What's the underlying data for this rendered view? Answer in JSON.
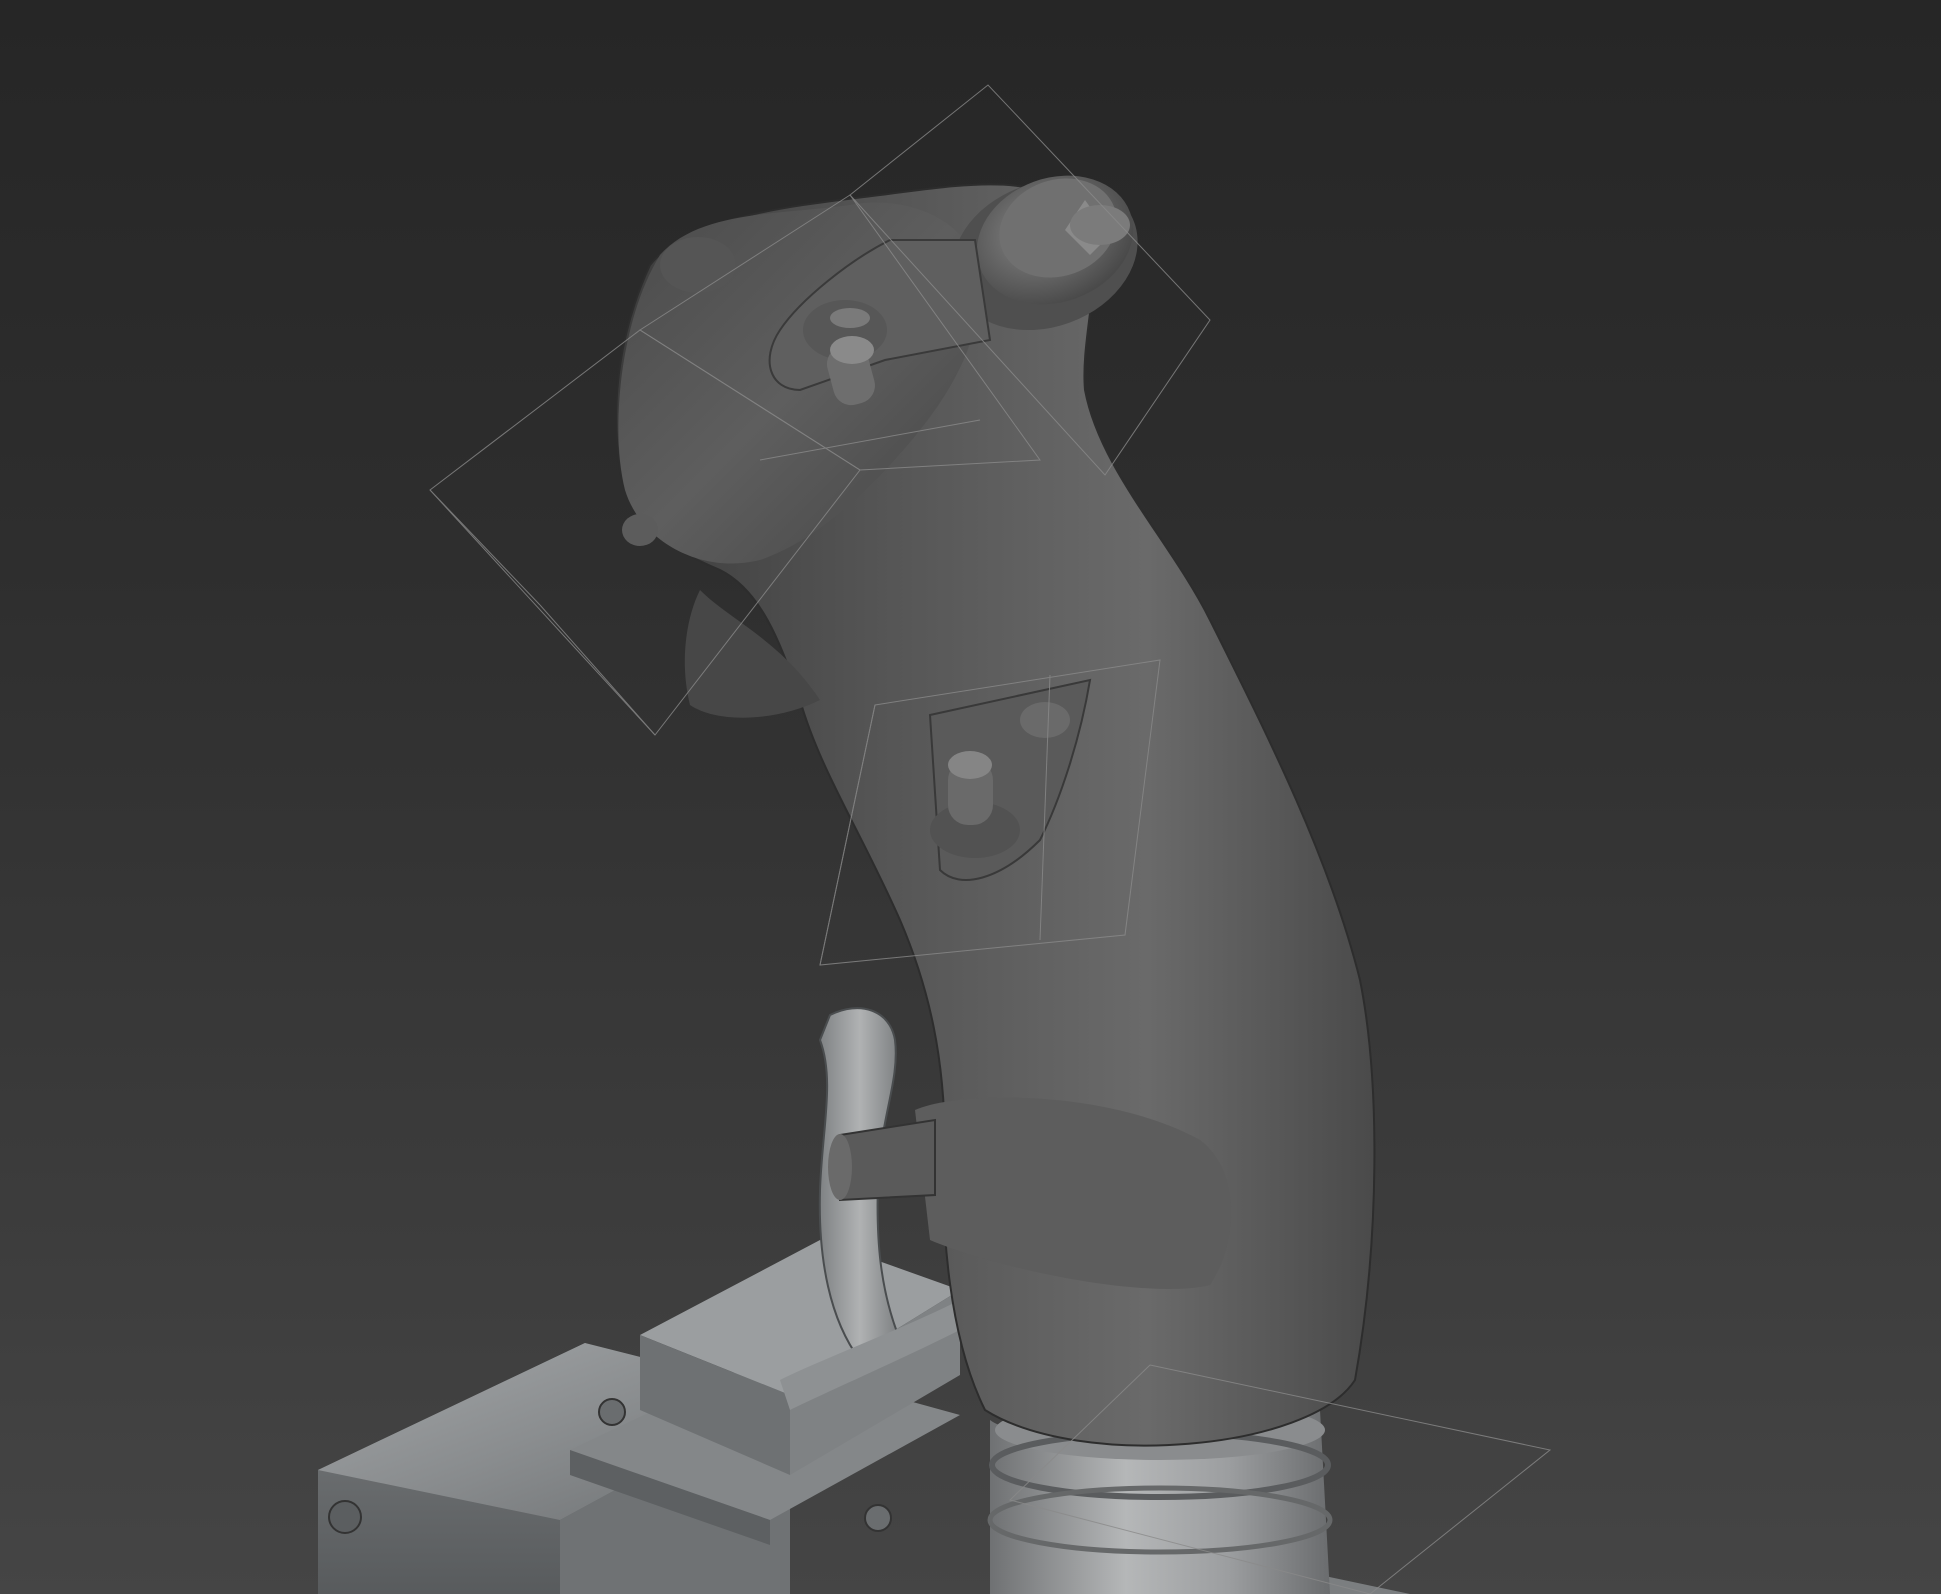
{
  "viewport": {
    "background_top": "#262626",
    "background_bottom": "#454545",
    "shading_mode": "shaded-with-edged-faces",
    "selection_gizmo_color": "#8a8a8a"
  },
  "scene": {
    "objects": [
      {
        "name": "joystick-grip",
        "material": "clay-gray",
        "color": "#5a5a5a"
      },
      {
        "name": "joystick-base-box",
        "material": "brushed-metal",
        "color": "#8c8f91"
      },
      {
        "name": "trigger-lever",
        "material": "worn-metal",
        "color": "#9a9c9e"
      },
      {
        "name": "hat-switch-top",
        "material": "clay-gray",
        "color": "#6a6a6a"
      },
      {
        "name": "toggle-switch-upper",
        "material": "clay-gray",
        "color": "#666666"
      },
      {
        "name": "toggle-switch-mid",
        "material": "clay-gray",
        "color": "#666666"
      },
      {
        "name": "collar-ring",
        "material": "brushed-metal",
        "color": "#a7a9aa"
      }
    ]
  }
}
